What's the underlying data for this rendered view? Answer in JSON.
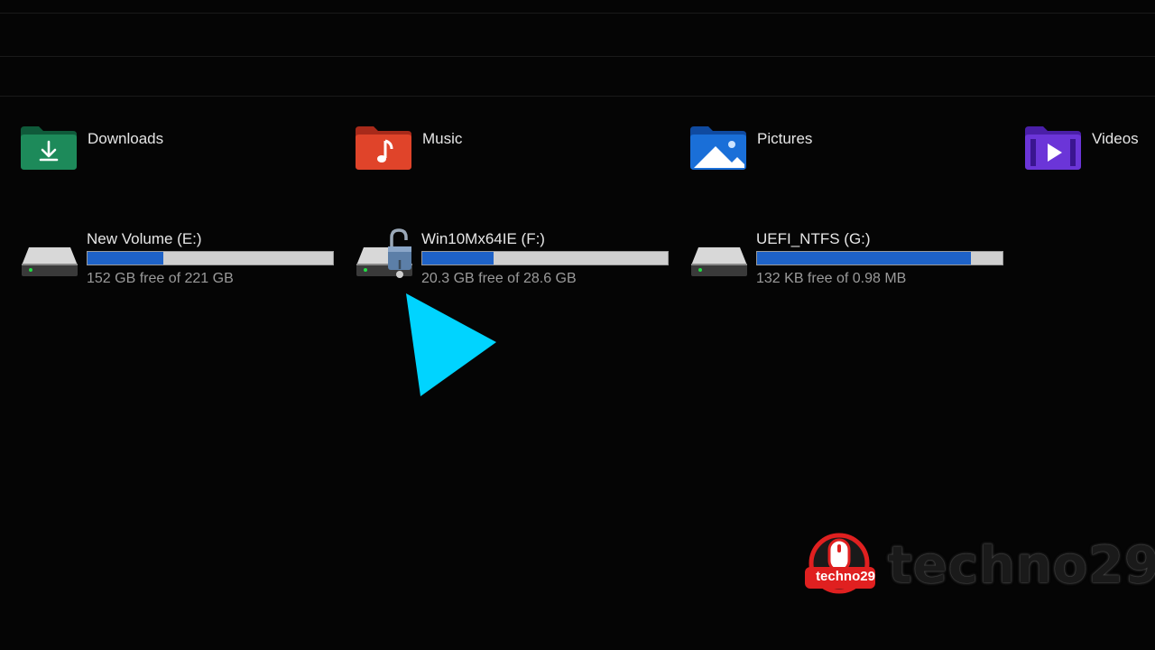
{
  "folders": [
    {
      "label": "Downloads",
      "icon": "downloads-folder-icon",
      "color": "#1d8a5a"
    },
    {
      "label": "Music",
      "icon": "music-folder-icon",
      "color": "#e0442a"
    },
    {
      "label": "Pictures",
      "icon": "pictures-folder-icon",
      "color": "#1a6fd8"
    },
    {
      "label": "Videos",
      "icon": "videos-folder-icon",
      "color": "#6b35d8"
    }
  ],
  "drives": [
    {
      "name": "New Volume (E:)",
      "free_text": "152 GB free of 221 GB",
      "used_fraction": 0.31,
      "icon": "hard-drive-icon"
    },
    {
      "name": "Win10Mx64IE (F:)",
      "free_text": "20.3 GB free of 28.6 GB",
      "used_fraction": 0.29,
      "icon": "locked-drive-icon"
    },
    {
      "name": "UEFI_NTFS (G:)",
      "free_text": "132 KB free of 0.98 MB",
      "used_fraction": 0.87,
      "icon": "hard-drive-icon"
    }
  ],
  "overlay": {
    "play_icon": "play-icon",
    "play_color": "#00d4ff"
  },
  "watermark": {
    "badge_text": "techno29",
    "text": "techno29",
    "accent": "#e02020"
  },
  "colors": {
    "bar_fill": "#1e62c7",
    "bar_track": "#cfcfcf"
  }
}
